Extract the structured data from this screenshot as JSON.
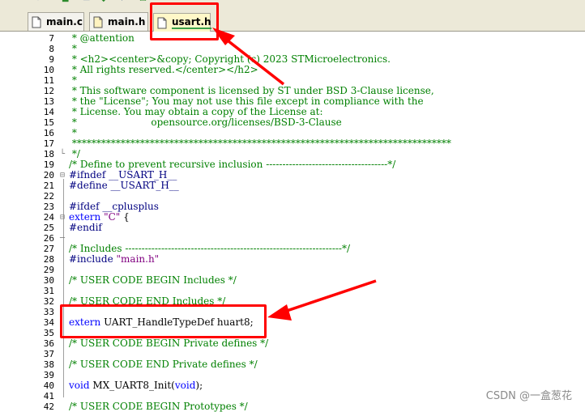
{
  "tabs": [
    {
      "label": "main.c",
      "active": false
    },
    {
      "label": "main.h",
      "active": false
    },
    {
      "label": "usart.h",
      "active": true
    }
  ],
  "code_lines": [
    {
      "num": "7",
      "text": " * @attention",
      "style": "com",
      "fold": ""
    },
    {
      "num": "8",
      "text": " *",
      "style": "com",
      "fold": ""
    },
    {
      "num": "9",
      "text": " * <h2><center>&copy; Copyright (c) 2023 STMicroelectronics.",
      "style": "com",
      "fold": ""
    },
    {
      "num": "10",
      "text": " * All rights reserved.</center></h2>",
      "style": "com",
      "fold": ""
    },
    {
      "num": "11",
      "text": " *",
      "style": "com",
      "fold": ""
    },
    {
      "num": "12",
      "text": " * This software component is licensed by ST under BSD 3-Clause license,",
      "style": "com",
      "fold": ""
    },
    {
      "num": "13",
      "text": " * the \"License\"; You may not use this file except in compliance with the",
      "style": "com",
      "fold": ""
    },
    {
      "num": "14",
      "text": " * License. You may obtain a copy of the License at:",
      "style": "com",
      "fold": ""
    },
    {
      "num": "15",
      "text": " *                        opensource.org/licenses/BSD-3-Clause",
      "style": "com",
      "fold": ""
    },
    {
      "num": "16",
      "text": " *",
      "style": "com",
      "fold": ""
    },
    {
      "num": "17",
      "text": " ******************************************************************************",
      "style": "com",
      "fold": ""
    },
    {
      "num": "18",
      "text": " */",
      "style": "com",
      "fold": "└"
    },
    {
      "num": "19",
      "text": "/* Define to prevent recursive inclusion -------------------------------------*/",
      "style": "com",
      "fold": ""
    },
    {
      "num": "20",
      "text": "#ifndef __USART_H__",
      "style": "dir",
      "fold": "⊟"
    },
    {
      "num": "21",
      "text": "#define __USART_H__",
      "style": "dir",
      "fold": ""
    },
    {
      "num": "22",
      "text": "",
      "style": "plain",
      "fold": ""
    },
    {
      "num": "23",
      "text": "#ifdef __cplusplus",
      "style": "dir",
      "fold": ""
    },
    {
      "num": "24",
      "text": "extern \"C\" {",
      "style": "kw",
      "fold": "⊟"
    },
    {
      "num": "25",
      "text": "#endif",
      "style": "dir",
      "fold": ""
    },
    {
      "num": "26",
      "text": "",
      "style": "plain",
      "fold": "─"
    },
    {
      "num": "27",
      "text": "/* Includes ------------------------------------------------------------------*/",
      "style": "com",
      "fold": ""
    },
    {
      "num": "28",
      "text": "#include \"main.h\"",
      "style": "dir",
      "fold": ""
    },
    {
      "num": "29",
      "text": "",
      "style": "plain",
      "fold": ""
    },
    {
      "num": "30",
      "text": "/* USER CODE BEGIN Includes */",
      "style": "com",
      "fold": ""
    },
    {
      "num": "31",
      "text": "",
      "style": "plain",
      "fold": ""
    },
    {
      "num": "32",
      "text": "/* USER CODE END Includes */",
      "style": "com",
      "fold": ""
    },
    {
      "num": "33",
      "text": "",
      "style": "plain",
      "fold": ""
    },
    {
      "num": "34",
      "text": "extern UART_HandleTypeDef huart8;",
      "style": "kw",
      "fold": ""
    },
    {
      "num": "35",
      "text": "",
      "style": "plain",
      "fold": ""
    },
    {
      "num": "36",
      "text": "/* USER CODE BEGIN Private defines */",
      "style": "com",
      "fold": ""
    },
    {
      "num": "37",
      "text": "",
      "style": "plain",
      "fold": ""
    },
    {
      "num": "38",
      "text": "/* USER CODE END Private defines */",
      "style": "com",
      "fold": ""
    },
    {
      "num": "39",
      "text": "",
      "style": "plain",
      "fold": ""
    },
    {
      "num": "40",
      "text": "void MX_UART8_Init(void);",
      "style": "kw",
      "fold": ""
    },
    {
      "num": "41",
      "text": "",
      "style": "plain",
      "fold": ""
    },
    {
      "num": "42",
      "text": "/* USER CODE BEGIN Prototypes */",
      "style": "com",
      "fold": ""
    }
  ],
  "watermark": "CSDN @一盒葱花",
  "colors": {
    "annotation": "#ff0000",
    "comment": "#008000",
    "keyword": "#0000ff",
    "directive": "#000080",
    "string": "#800080",
    "active_tab": "#fff8c8"
  }
}
